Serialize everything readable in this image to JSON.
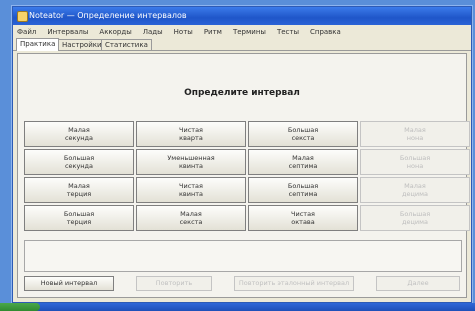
{
  "window": {
    "title": "Noteator — Определение интервалов"
  },
  "menu": [
    "Файл",
    "Интервалы",
    "Аккорды",
    "Лады",
    "Ноты",
    "Ритм",
    "Термины",
    "Тесты",
    "Справка"
  ],
  "tabs": [
    "Практика",
    "Настройки",
    "Статистика"
  ],
  "heading": "Определите интервал",
  "grid": [
    [
      {
        "label": "Малая\nсекунда",
        "enabled": true
      },
      {
        "label": "Чистая\nкварта",
        "enabled": true
      },
      {
        "label": "Большая\nсекста",
        "enabled": true
      },
      {
        "label": "Малая\nнона",
        "enabled": false
      }
    ],
    [
      {
        "label": "Большая\nсекунда",
        "enabled": true
      },
      {
        "label": "Уменьшенная\nквинта",
        "enabled": true
      },
      {
        "label": "Малая\nсептима",
        "enabled": true
      },
      {
        "label": "Большая\nнона",
        "enabled": false
      }
    ],
    [
      {
        "label": "Малая\nтерция",
        "enabled": true
      },
      {
        "label": "Чистая\nквинта",
        "enabled": true
      },
      {
        "label": "Большая\nсептима",
        "enabled": true
      },
      {
        "label": "Малая\nдецима",
        "enabled": false
      }
    ],
    [
      {
        "label": "Большая\nтерция",
        "enabled": true
      },
      {
        "label": "Малая\nсекста",
        "enabled": true
      },
      {
        "label": "Чистая\nоктава",
        "enabled": true
      },
      {
        "label": "Большая\nдецима",
        "enabled": false
      }
    ]
  ],
  "buttons": {
    "new_interval": "Новый интервал",
    "repeat": "Повторить",
    "play_reference": "Повторить эталонный интервал",
    "next": "Далее"
  }
}
